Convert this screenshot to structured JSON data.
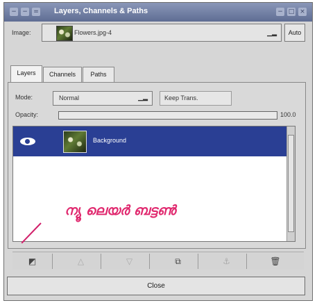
{
  "window": {
    "title": "Layers, Channels & Paths"
  },
  "image_row": {
    "label": "Image:",
    "selected": "Flowers.jpg-4",
    "auto_label": "Auto"
  },
  "tabs": [
    {
      "label": "Layers"
    },
    {
      "label": "Channels"
    },
    {
      "label": "Paths"
    }
  ],
  "mode_row": {
    "label": "Mode:",
    "selected": "Normal",
    "keep_trans_label": "Keep Trans."
  },
  "opacity": {
    "label": "Opacity:",
    "value_text": "100.0",
    "value": 1.0
  },
  "layers": [
    {
      "name": "Background",
      "visible": true,
      "selected": true
    }
  ],
  "annotation": {
    "text": "ന്യൂ ലെയർ ബട്ടൺ",
    "color": "#e0286e"
  },
  "toolbar": {
    "buttons": [
      {
        "icon": "new-layer-icon",
        "glyph": "◩",
        "enabled": true
      },
      {
        "icon": "raise-layer-icon",
        "glyph": "△",
        "enabled": false
      },
      {
        "icon": "lower-layer-icon",
        "glyph": "▽",
        "enabled": false
      },
      {
        "icon": "duplicate-layer-icon",
        "glyph": "⧉",
        "enabled": true
      },
      {
        "icon": "anchor-layer-icon",
        "glyph": "⚓",
        "enabled": false
      },
      {
        "icon": "delete-layer-icon",
        "glyph": "🗑",
        "enabled": true
      }
    ]
  },
  "close_label": "Close",
  "colors": {
    "selection": "#2a3f94",
    "titlebar": "#5f6d93"
  }
}
